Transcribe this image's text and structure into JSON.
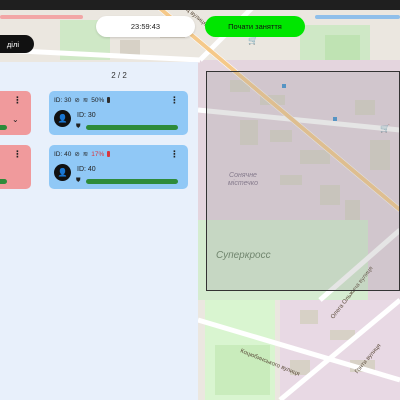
{
  "header": {
    "timer": "23:59:43",
    "start_button": "Почати заняття",
    "sections_button": "ділі"
  },
  "panel": {
    "page_indicator": "2 / 2",
    "cards": [
      {
        "status_id": "ID: 30",
        "battery_pct": "50%",
        "battery_low": false,
        "label": "ID: 30",
        "progress": 1.0,
        "color": "#90c8f6"
      },
      {
        "status_id": "ID: 40",
        "battery_pct": "17%",
        "battery_low": true,
        "label": "ID: 40",
        "progress": 1.0,
        "color": "#90c8f6"
      }
    ],
    "partial_cards_color": "#f09a9c"
  },
  "map": {
    "zone_label_1": "Сонячне містечко",
    "zone_label_2": "Суперкросс",
    "street_1": "Олега Ольжича вулиця",
    "street_2": "Коцюбинського вулиця",
    "street_3": "Гонти вулиця",
    "street_4": "Ц вулиця"
  },
  "colors": {
    "start_button": "#00e600",
    "progress_bar": "#2e8b3a",
    "warning": "#d9363e"
  }
}
